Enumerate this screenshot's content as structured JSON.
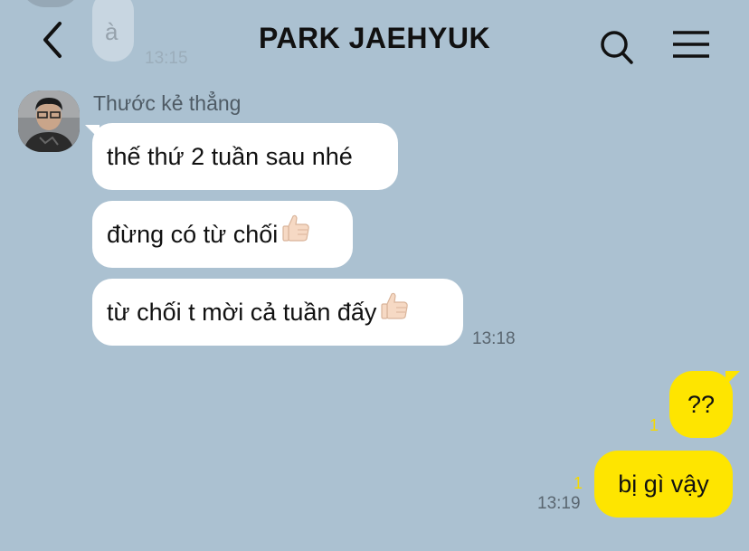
{
  "header": {
    "title": "PARK JAEHYUK",
    "back_icon": "chevron-left-icon",
    "search_icon": "search-icon",
    "menu_icon": "hamburger-menu-icon"
  },
  "previous": {
    "text": "à",
    "time": "13:15"
  },
  "incoming": {
    "sender": "Thước kẻ thẳng",
    "messages": [
      {
        "text": "thế thứ 2 tuần sau nhé"
      },
      {
        "text": "đừng có từ chối",
        "emoji": "thumbs-up-icon"
      },
      {
        "text": "từ chối t mời cả tuần đấy",
        "emoji": "thumbs-up-icon"
      }
    ],
    "time": "13:18"
  },
  "outgoing": {
    "messages": [
      {
        "text": "??",
        "unread": "1"
      },
      {
        "text": "bị gì vậy",
        "unread": "1"
      }
    ],
    "time": "13:19"
  },
  "colors": {
    "background": "#abc1d1",
    "incoming_bubble": "#ffffff",
    "outgoing_bubble": "#fee500",
    "unread_count": "#f5d900"
  }
}
